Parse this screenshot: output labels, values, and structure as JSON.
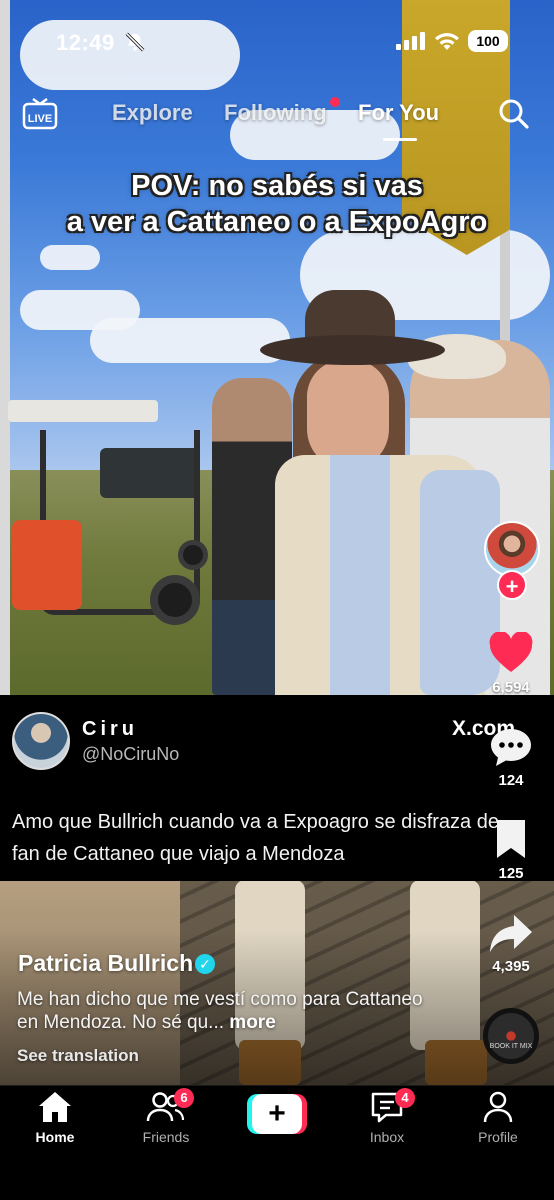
{
  "status_bar": {
    "time": "12:49",
    "battery": "100",
    "icons": [
      "mute-bell-icon",
      "cellular-signal-icon",
      "wifi-icon",
      "battery-icon"
    ]
  },
  "top_nav": {
    "live_label": "LIVE",
    "tabs": [
      {
        "label": "Explore"
      },
      {
        "label": "Following"
      },
      {
        "label": "For You"
      }
    ],
    "active_tab": "For You",
    "accent_color": "#fe2c55"
  },
  "video": {
    "caption_line1": "POV: no sabés si vas",
    "caption_line2": "a ver a Cattaneo o a ExpoAgro"
  },
  "tweet": {
    "name": "Ciru",
    "handle": "@NoCiruNo",
    "source": "X.com",
    "text": "Amo que Bullrich cuando va a Expoagro se disfraza de fan de Cattaneo que viajo a Mendoza"
  },
  "actions": {
    "likes": "6,594",
    "comments": "124",
    "saves": "125",
    "shares": "4,395",
    "like_color": "#fe2c55"
  },
  "post": {
    "author": "Patricia Bullrich",
    "verified_color": "#20d5ec",
    "description": "Me han dicho que me vestí como para Cattaneo en Mendoza. No sé qu...",
    "more": "more",
    "see_translation": "See translation",
    "sound_label": "BOOK IT MIX"
  },
  "tab_bar": {
    "home": "Home",
    "friends": "Friends",
    "friends_badge": "6",
    "inbox": "Inbox",
    "inbox_badge": "4",
    "profile": "Profile",
    "create": "+"
  }
}
